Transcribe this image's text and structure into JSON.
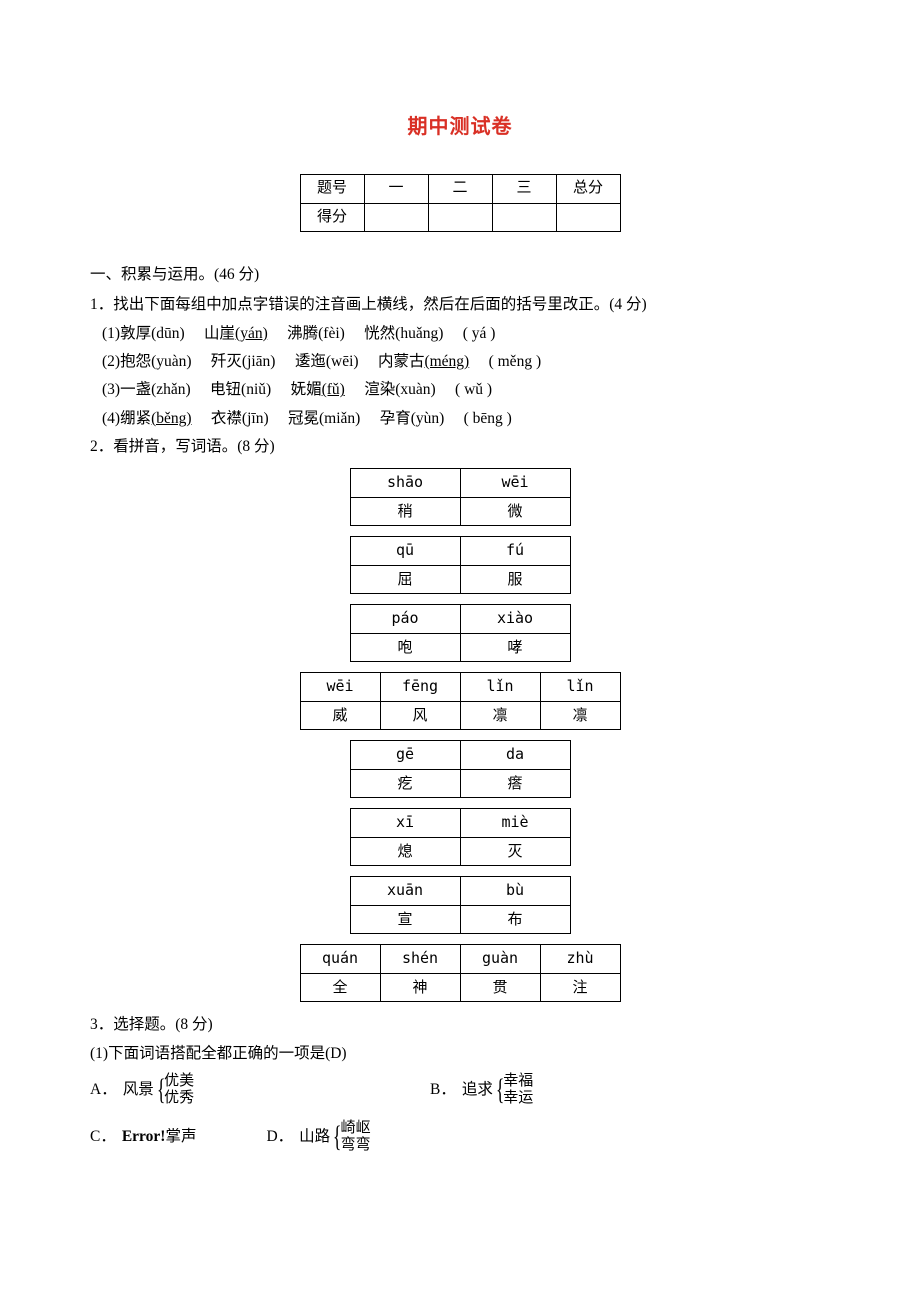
{
  "title": "期中测试卷",
  "score_header": [
    "题号",
    "一",
    "二",
    "三",
    "总分"
  ],
  "score_row_label": "得分",
  "section1": {
    "heading": "一、积累与运用。(46 分)",
    "q1": {
      "stem": "1．找出下面每组中加点字错误的注音画上横线，然后在后面的括号里改正。(4 分)",
      "lines": [
        {
          "no": "(1)",
          "items": [
            [
              "敦厚",
              "(dūn)"
            ],
            [
              "山崖",
              "(yán)",
              true
            ],
            [
              "沸腾",
              "(fèi)"
            ],
            [
              "恍然",
              "(huǎng)"
            ]
          ],
          "ans": "yá"
        },
        {
          "no": "(2)",
          "items": [
            [
              "抱怨",
              "(yuàn)"
            ],
            [
              "歼灭",
              "(jiān)"
            ],
            [
              "逶迤",
              "(wēi)"
            ],
            [
              "内蒙古",
              "(méng)",
              true
            ]
          ],
          "ans": "měng"
        },
        {
          "no": "(3)",
          "items": [
            [
              "一盏",
              "(zhǎn)"
            ],
            [
              "电钮",
              "(niǔ)"
            ],
            [
              "妩媚",
              "(fǔ)",
              true
            ],
            [
              "渲染",
              "(xuàn)"
            ]
          ],
          "ans": "wǔ"
        },
        {
          "no": "(4)",
          "items": [
            [
              "绷紧",
              "(běng)",
              true
            ],
            [
              "衣襟",
              "(jīn)"
            ],
            [
              "冠冕",
              "(miǎn)"
            ],
            [
              "孕育",
              "(yùn)"
            ]
          ],
          "ans": "bēng"
        }
      ]
    },
    "q2": {
      "stem": "2．看拼音，写词语。(8 分)",
      "tables": [
        {
          "cols": 2,
          "pinyin": [
            "shāo",
            "wēi"
          ],
          "chars": [
            "稍",
            "微"
          ]
        },
        {
          "cols": 2,
          "pinyin": [
            "qū",
            "fú"
          ],
          "chars": [
            "屈",
            "服"
          ]
        },
        {
          "cols": 2,
          "pinyin": [
            "páo",
            "xiào"
          ],
          "chars": [
            "咆",
            "哮"
          ]
        },
        {
          "cols": 4,
          "pinyin": [
            "wēi",
            "fēng",
            "lǐn",
            "lǐn"
          ],
          "chars": [
            "威",
            "风",
            "凛",
            "凛"
          ]
        },
        {
          "cols": 2,
          "pinyin": [
            "gē",
            "da"
          ],
          "chars": [
            "疙",
            "瘩"
          ]
        },
        {
          "cols": 2,
          "pinyin": [
            "xī",
            "miè"
          ],
          "chars": [
            "熄",
            "灭"
          ]
        },
        {
          "cols": 2,
          "pinyin": [
            "xuān",
            "bù"
          ],
          "chars": [
            "宣",
            "布"
          ]
        },
        {
          "cols": 4,
          "pinyin": [
            "quán",
            "shén",
            "guàn",
            "zhù"
          ],
          "chars": [
            "全",
            "神",
            "贯",
            "注"
          ]
        }
      ]
    },
    "q3": {
      "stem": "3．选择题。(8 分)",
      "sub1": {
        "stem": "(1)下面词语搭配全都正确的一项是(D)",
        "A": {
          "label": "A．",
          "prefix": "风景",
          "top": "优美",
          "bottom": "优秀"
        },
        "B": {
          "label": "B．",
          "prefix": "追求",
          "top": "幸福",
          "bottom": "幸运"
        },
        "C": {
          "label": "C．",
          "text": "Error!",
          "suffix": "掌声"
        },
        "D": {
          "label": "D．",
          "prefix": "山路",
          "top": "崎岖",
          "bottom": "弯弯"
        }
      }
    }
  }
}
